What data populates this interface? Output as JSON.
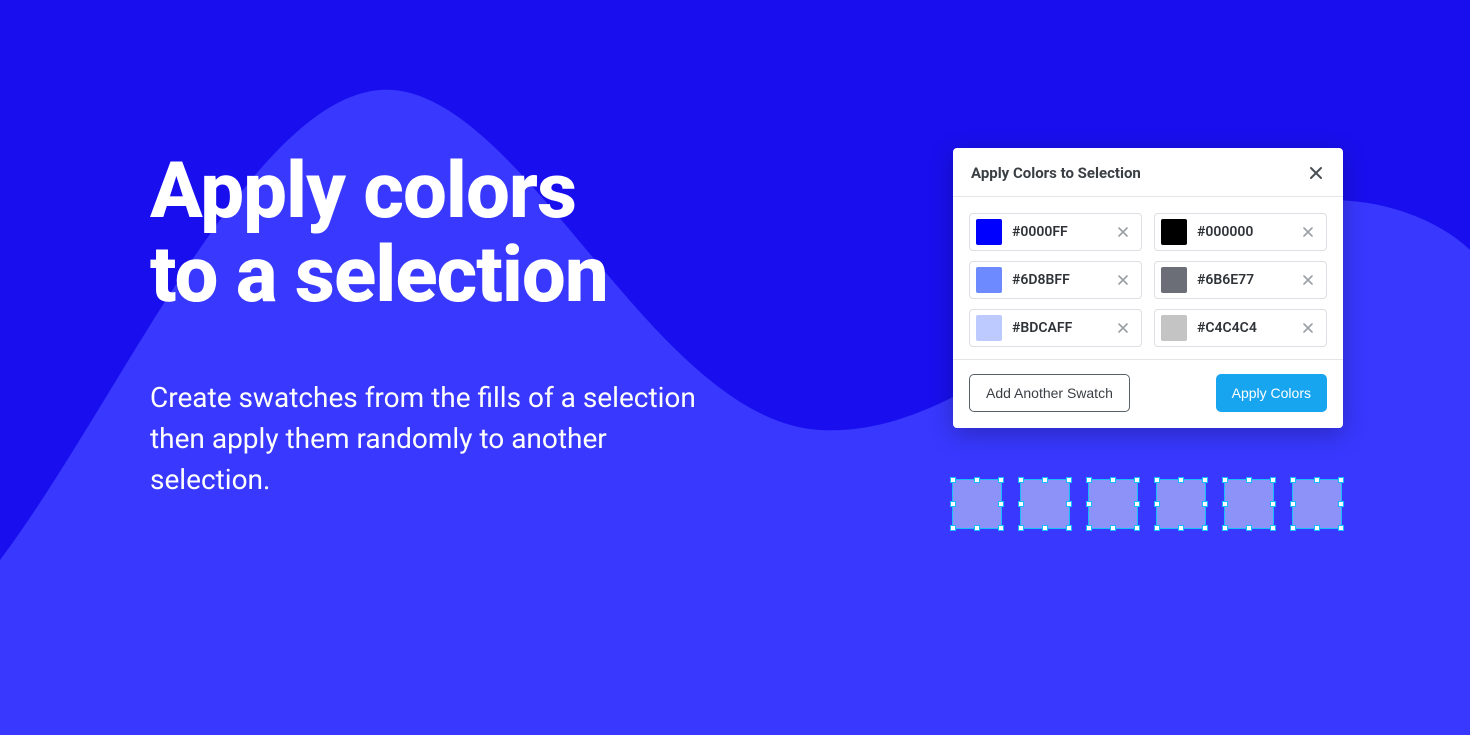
{
  "hero": {
    "title_line1": "Apply colors",
    "title_line2": "to a selection",
    "subtitle": "Create swatches from the fills of a selection then apply them randomly to another selection."
  },
  "panel": {
    "title": "Apply Colors to Selection",
    "swatches": [
      {
        "hex": "#0000FF",
        "color": "#0000FF"
      },
      {
        "hex": "#000000",
        "color": "#000000"
      },
      {
        "hex": "#6D8BFF",
        "color": "#6D8BFF"
      },
      {
        "hex": "#6B6E77",
        "color": "#6B6E77"
      },
      {
        "hex": "#BDCAFF",
        "color": "#BDCAFF"
      },
      {
        "hex": "#C4C4C4",
        "color": "#C4C4C4"
      }
    ],
    "add_label": "Add Another Swatch",
    "apply_label": "Apply Colors"
  },
  "selection": {
    "count": 6,
    "fill": "#8c92f8"
  },
  "colors": {
    "background": "#190fee",
    "wave": "#3838ff",
    "primary_button": "#18a5ef"
  }
}
